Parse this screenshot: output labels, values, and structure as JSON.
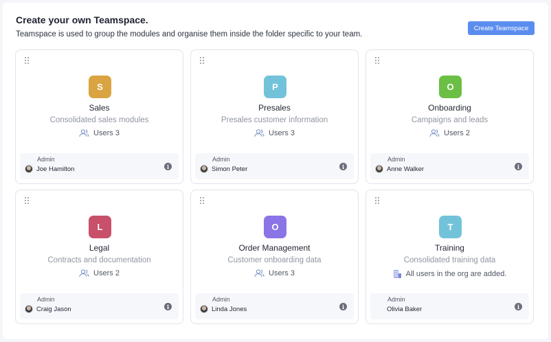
{
  "header": {
    "title": "Create your own Teamspace.",
    "subtitle": "Teamspace is used to group the modules and organise them inside the folder specific to your team.",
    "create_button": "Create Teamspace"
  },
  "labels": {
    "admin": "Admin",
    "info_icon": "i"
  },
  "cards": [
    {
      "letter": "S",
      "color": "#d9a441",
      "name": "Sales",
      "description": "Consolidated sales modules",
      "users": "Users 3",
      "users_icon": "users-icon",
      "admin": "Joe Hamilton"
    },
    {
      "letter": "P",
      "color": "#72c3d9",
      "name": "Presales",
      "description": "Presales customer information",
      "users": "Users 3",
      "users_icon": "users-icon",
      "admin": "Simon Peter"
    },
    {
      "letter": "O",
      "color": "#6cbf45",
      "name": "Onboarding",
      "description": "Campaigns and leads",
      "users": "Users 2",
      "users_icon": "users-icon",
      "admin": "Anne Walker"
    },
    {
      "letter": "L",
      "color": "#c8506a",
      "name": "Legal",
      "description": "Contracts and documentation",
      "users": "Users 2",
      "users_icon": "users-icon",
      "admin": "Craig Jason"
    },
    {
      "letter": "O",
      "color": "#8b74e6",
      "name": "Order Management",
      "description": "Customer onboarding data",
      "users": "Users 3",
      "users_icon": "users-icon",
      "admin": "Linda Jones"
    },
    {
      "letter": "T",
      "color": "#72c3d9",
      "name": "Training",
      "description": "Consolidated training data",
      "users": "All users in the org are added.",
      "users_icon": "org-building-icon",
      "admin": "Olivia Baker",
      "no_avatar": true
    }
  ]
}
